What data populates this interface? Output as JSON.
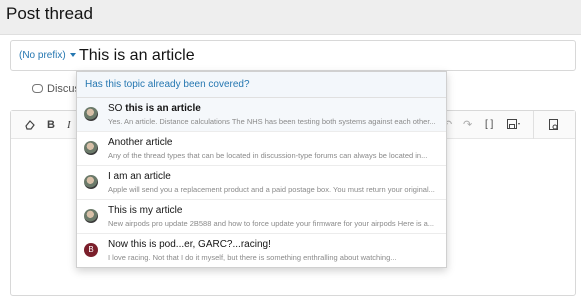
{
  "page": {
    "title": "Post thread"
  },
  "title_field": {
    "prefix_label": "(No prefix)",
    "value": "This is an article"
  },
  "tabs": {
    "discussion_label": "Discus"
  },
  "suggestions": {
    "heading": "Has this topic already been covered?",
    "items": [
      {
        "title_prefix": "SO ",
        "title_match": "this is an article",
        "snippet": "Yes. An article. Distance calculations The NHS has been testing both systems against each other...",
        "avatar": "photo",
        "active": true
      },
      {
        "title_prefix": "",
        "title_match": "Another article",
        "snippet": "Any of the thread types that can be located in discussion-type forums can always be located in...",
        "avatar": "photo"
      },
      {
        "title_prefix": "",
        "title_match": "I am an article",
        "snippet": "Apple will send you a replacement product and a paid postage box. You must return your original...",
        "avatar": "photo"
      },
      {
        "title_prefix": "",
        "title_match": "This is my article",
        "snippet": "New airpods pro update 2B588 and how to force update your firmware for your airpods Here is a...",
        "avatar": "photo"
      },
      {
        "title_prefix": "",
        "title_match": "Now this is pod...er, GARC?...racing!",
        "snippet": "I love racing. Not that I do it myself, but there is something enthralling about watching...",
        "avatar": "letter",
        "avatar_letter": "B"
      }
    ]
  },
  "toolbar": {
    "bold": "B",
    "italic": "I",
    "bbcode": "[ ]"
  },
  "colors": {
    "accent": "#2577b1",
    "avatar_letter_bg": "#7b1f2b"
  }
}
